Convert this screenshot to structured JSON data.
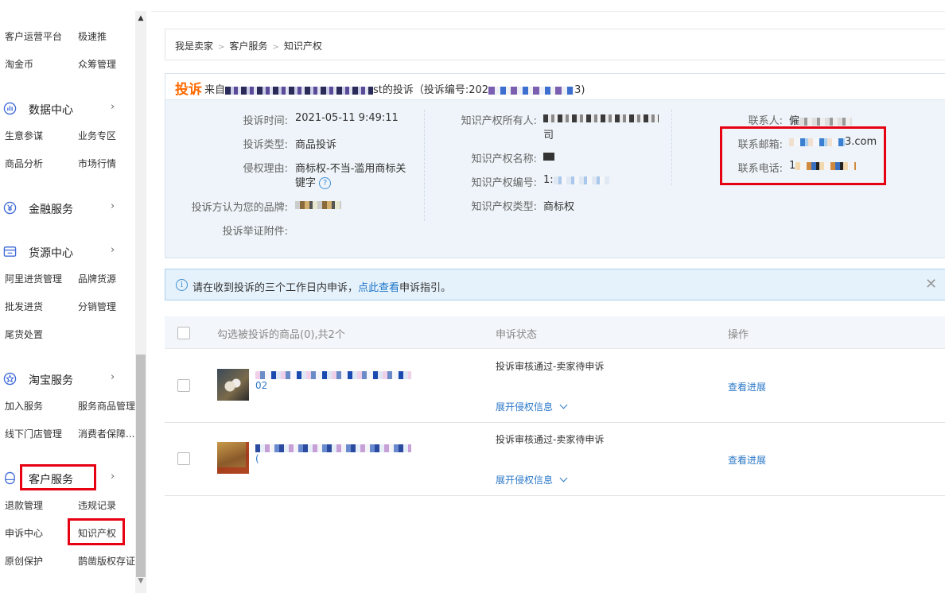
{
  "sidebar": {
    "rows": [
      {
        "a": "客户运营平台",
        "b": "极速推"
      },
      {
        "a": "淘金币",
        "b": "众筹管理"
      }
    ],
    "sections": [
      {
        "title": "数据中心",
        "icon": "chart-circle-icon",
        "items": [
          [
            "生意参谋",
            "业务专区"
          ],
          [
            "商品分析",
            "市场行情"
          ]
        ]
      },
      {
        "title": "金融服务",
        "icon": "yuan-circle-icon",
        "items": []
      },
      {
        "title": "货源中心",
        "icon": "box-icon",
        "items": [
          [
            "阿里进货管理",
            "品牌货源"
          ],
          [
            "批发进货",
            "分销管理"
          ],
          [
            "尾货处置",
            ""
          ]
        ]
      },
      {
        "title": "淘宝服务",
        "icon": "star-circle-icon",
        "items": [
          [
            "加入服务",
            "服务商品管理"
          ],
          [
            "线下门店管理",
            "消费者保障..."
          ]
        ]
      },
      {
        "title": "客户服务",
        "icon": "user-icon",
        "items": [
          [
            "退款管理",
            "违规记录"
          ],
          [
            "申诉中心",
            "知识产权"
          ],
          [
            "原创保护",
            "鹊凿版权存证"
          ]
        ]
      }
    ],
    "arrow": "›"
  },
  "breadcrumb": {
    "items": [
      "我是卖家",
      "客户服务",
      "知识产权"
    ],
    "sep": ">"
  },
  "complaint": {
    "tag": "投诉",
    "header_prefix": "来自",
    "header_mid": "st的投诉（投诉编号:202",
    "header_suffix": "3)",
    "fields": {
      "time_label": "投诉时间:",
      "time_value": "2021-05-11 9:49:11",
      "type_label": "投诉类型:",
      "type_value": "商品投诉",
      "reason_label": "侵权理由:",
      "reason_value_1": "商标权-不当-滥用商标关",
      "reason_value_2": "键字",
      "brand_label": "投诉方认为您的品牌:",
      "attach_label": "投诉举证附件:",
      "owner_label": "知识产权所有人:",
      "owner_value_2": "司",
      "ipname_label": "知识产权名称:",
      "ipno_label": "知识产权编号:",
      "ipno_value": "1:",
      "iptype_label": "知识产权类型:",
      "iptype_value": "商标权",
      "contact_label": "联系人:",
      "contact_value": "僱",
      "email_label": "联系邮箱:",
      "email_value": "3.com",
      "phone_label": "联系电话:",
      "phone_value": "1"
    }
  },
  "notice": {
    "text_before": "请在收到投诉的三个工作日内申诉，",
    "link": "点此查看",
    "text_after": "申诉指引。",
    "close": "✕"
  },
  "table": {
    "headers": {
      "goods": "勾选被投诉的商品(0),共2个",
      "status": "申诉状态",
      "op": "操作"
    },
    "rows": [
      {
        "status": "投诉审核通过-卖家待申诉",
        "expand": "展开侵权信息",
        "op": "查看进展",
        "name_tail": "02"
      },
      {
        "status": "投诉审核通过-卖家待申诉",
        "expand": "展开侵权信息",
        "op": "查看进展",
        "name_tail": "("
      }
    ]
  }
}
